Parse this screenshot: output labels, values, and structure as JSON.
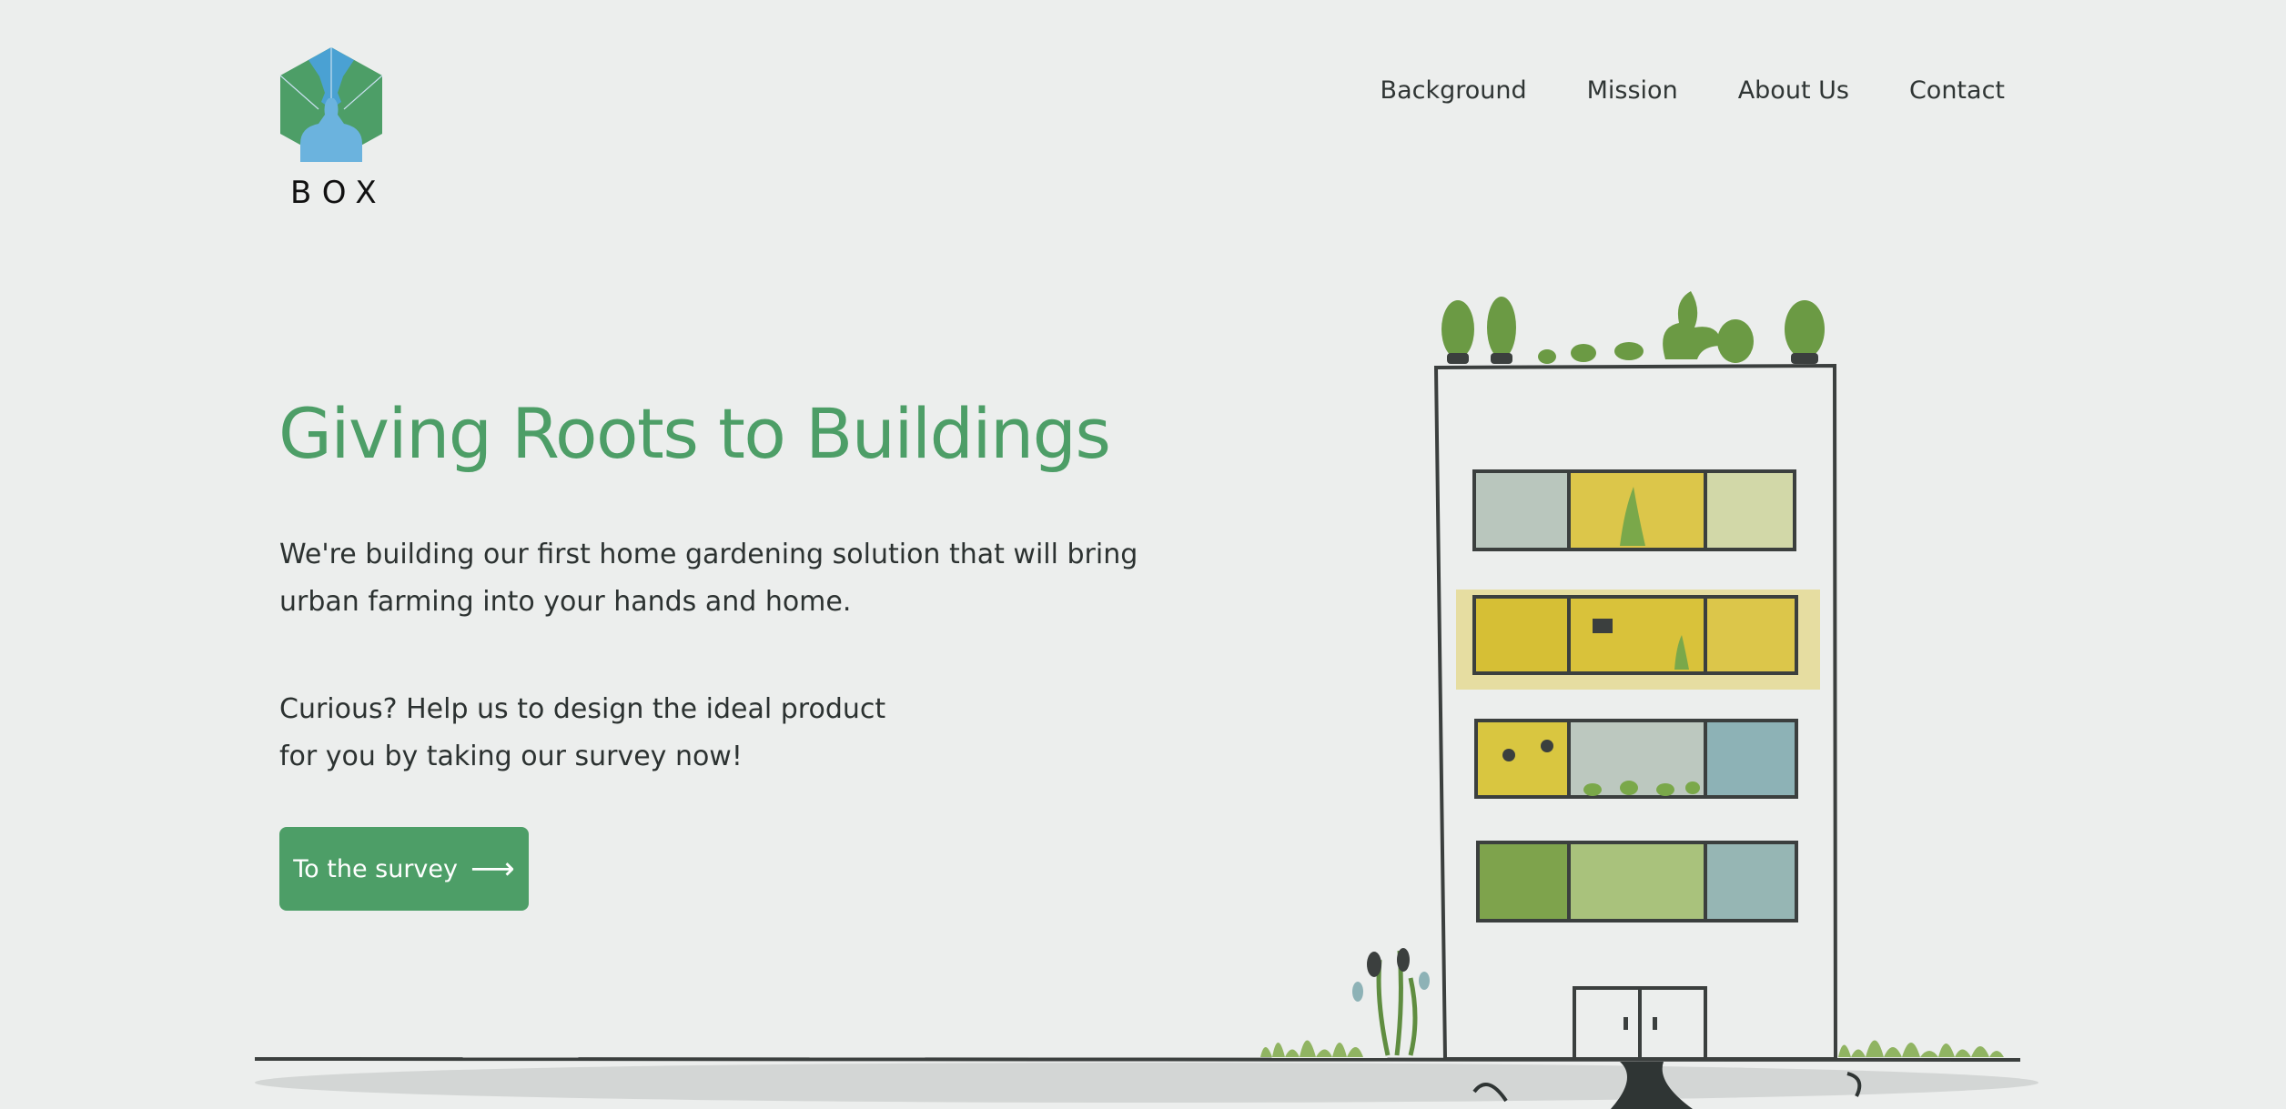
{
  "logo": {
    "text": "BOX",
    "icon": "hexagon-people-icon"
  },
  "nav": {
    "items": [
      "Background",
      "Mission",
      "About Us",
      "Contact"
    ]
  },
  "hero": {
    "title": "Giving Roots to Buildings",
    "text_line1": "We're building our first home gardening solution that will bring",
    "text_line2": "urban farming into your hands and home.",
    "text_line3": "Curious? Help us to design the ideal product",
    "text_line4": "for you by taking our survey now!",
    "cta_label": "To the survey",
    "cta_icon": "arrow-right-icon"
  },
  "colors": {
    "accent": "#4d9e67",
    "background": "#eceeed",
    "text": "#2d3433",
    "logo_blue": "#4aa1d3",
    "window_yellow": "#d9c23a",
    "window_teal": "#8db2b6"
  }
}
